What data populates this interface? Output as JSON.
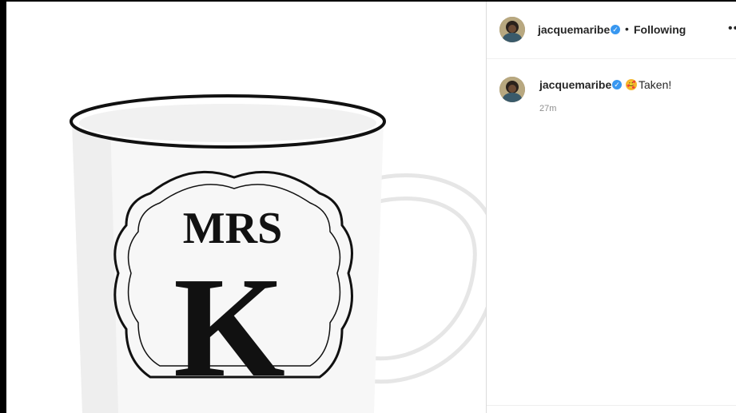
{
  "post": {
    "image": {
      "subject": "mug",
      "mug_text_top": "MRS",
      "mug_text_initial": "K"
    },
    "header": {
      "username": "jacquemaribe",
      "separator": "•",
      "follow_status": "Following",
      "more_label": "••"
    },
    "caption": {
      "username": "jacquemaribe",
      "emoji": "🥰",
      "text": "Taken!",
      "timestamp": "27m"
    }
  },
  "colors": {
    "verified": "#3897f0",
    "text": "#262626",
    "muted": "#8e8e8e"
  }
}
